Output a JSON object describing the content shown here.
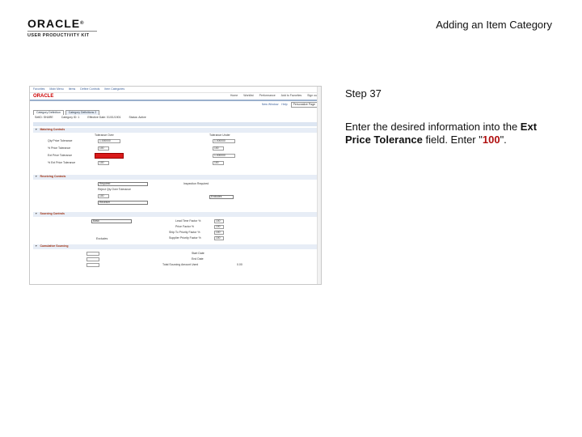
{
  "logo": {
    "word": "ORACLE",
    "reg": "®",
    "sub": "USER PRODUCTIVITY KIT"
  },
  "slide_title": "Adding an Item Category",
  "step": "Step 37",
  "instruction": {
    "pre": "Enter the desired information into the ",
    "field": "Ext Price Tolerance",
    "mid": " field. Enter \"",
    "value": "100",
    "post": "\"."
  },
  "app": {
    "brand": "ORACLE",
    "nav": [
      "Favorites",
      "Main Menu",
      "Items",
      "Define Controls",
      "Item Categories"
    ],
    "header_links": [
      "Home",
      "Worklist",
      "Performance",
      "Add to Favorites",
      "Sign out"
    ],
    "link_row": [
      "New Window",
      "Help",
      "Personalize Page"
    ],
    "tabs": [
      "Category Definition",
      "Category Definitions 2"
    ],
    "header_fields": [
      "SetID: SHARE",
      "Category ID: 1",
      "Effective Date: 01/01/1901",
      "Status: Active"
    ],
    "sections": {
      "matching": "Matching Controls",
      "receiving": "Receiving Controls",
      "sourcing": "Sourcing Controls",
      "cumulative": "Cumulative Sourcing"
    },
    "matching": {
      "col1": "Tolerance Over",
      "col2": "Tolerance Under",
      "rows": [
        {
          "label": "Qty Price Tolerance",
          "v1": "1.000000",
          "v2": "1.000000"
        },
        {
          "label": "% Price Tolerance",
          "v1": "100",
          "v2": "100"
        },
        {
          "label": "Ext Price Tolerance",
          "v1": "",
          "v2": "1.000000"
        },
        {
          "label": "% Ext Price Tolerance",
          "v1": "100",
          "v2": "100"
        }
      ]
    },
    "receiving": {
      "required": "Required",
      "vendor_defaults": "Reject Qty Over Tolerance",
      "receipt_tolerance": "100",
      "receive_line": "Receiver",
      "inspect_label": "Inspection Required",
      "inspect_val": "Excludes"
    },
    "sourcing": {
      "method": "Basic",
      "factors": [
        {
          "label": "Lead Time Factor %",
          "v": "100"
        },
        {
          "label": "Price Factor %",
          "v": "100"
        },
        {
          "label": "Ship To Priority Factor %",
          "v": "100"
        },
        {
          "label": "Supplier Priority Factor %",
          "v": "100"
        }
      ],
      "excludes": "Excludes"
    },
    "cumulative": {
      "rows": [
        "Start Date",
        "End Date",
        "Sourcing Amount"
      ],
      "right": [
        "Start Date",
        "End Date",
        "Total Sourcing Amount Used"
      ],
      "total": "0.00"
    }
  }
}
